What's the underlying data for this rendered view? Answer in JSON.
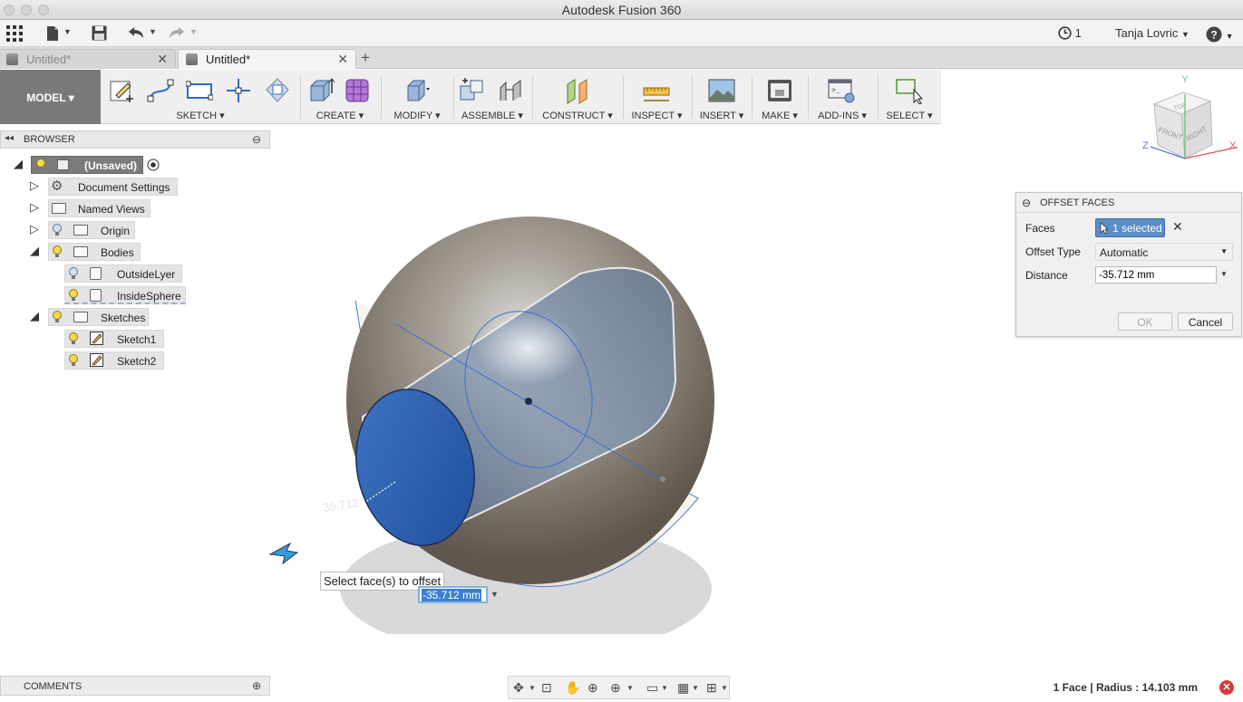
{
  "window": {
    "title": "Autodesk Fusion 360"
  },
  "qat": {
    "apps_icon": "grid-icon",
    "file_icon": "file-icon",
    "save_icon": "save-icon",
    "undo_icon": "undo-icon",
    "redo_icon": "redo-icon",
    "job_status_count": "1",
    "user_name": "Tanja Lovric",
    "help_icon": "help-icon"
  },
  "tabs": [
    {
      "label": "Untitled*",
      "active": false
    },
    {
      "label": "Untitled*",
      "active": true
    }
  ],
  "ribbon": {
    "workspace": "MODEL ▾",
    "groups": [
      {
        "label": "SKETCH ▾"
      },
      {
        "label": "CREATE ▾"
      },
      {
        "label": "MODIFY ▾"
      },
      {
        "label": "ASSEMBLE ▾"
      },
      {
        "label": "CONSTRUCT ▾"
      },
      {
        "label": "INSPECT ▾"
      },
      {
        "label": "INSERT ▾"
      },
      {
        "label": "MAKE ▾"
      },
      {
        "label": "ADD-INS ▾"
      },
      {
        "label": "SELECT ▾"
      }
    ]
  },
  "viewcube": {
    "top": "TOP",
    "front": "FRONT",
    "right": "RIGHT",
    "axis_x": "X",
    "axis_y": "Y",
    "axis_z": "Z"
  },
  "browser": {
    "title": "BROWSER",
    "root": "(Unsaved)",
    "items": [
      {
        "label": "Document Settings"
      },
      {
        "label": "Named Views"
      },
      {
        "label": "Origin"
      },
      {
        "label": "Bodies"
      },
      {
        "label": "OutsideLyer"
      },
      {
        "label": "InsideSphere"
      },
      {
        "label": "Sketches"
      },
      {
        "label": "Sketch1"
      },
      {
        "label": "Sketch2"
      }
    ]
  },
  "comments": {
    "title": "COMMENTS"
  },
  "dialog": {
    "title": "OFFSET FACES",
    "faces_label": "Faces",
    "faces_value": "1 selected",
    "offset_type_label": "Offset Type",
    "offset_type_value": "Automatic",
    "distance_label": "Distance",
    "distance_value": "-35.712 mm",
    "ok": "OK",
    "cancel": "Cancel"
  },
  "canvas": {
    "tooltip": "Select face(s) to offset",
    "input_value": "-35.712 mm",
    "dimension_label": "35.712"
  },
  "status": {
    "text": "1 Face | Radius : 14.103 mm"
  },
  "colors": {
    "ribbon_workspace": "#7a7a7a",
    "selection_blue": "#5b8ec6",
    "face_blue": "#2a5fae"
  }
}
